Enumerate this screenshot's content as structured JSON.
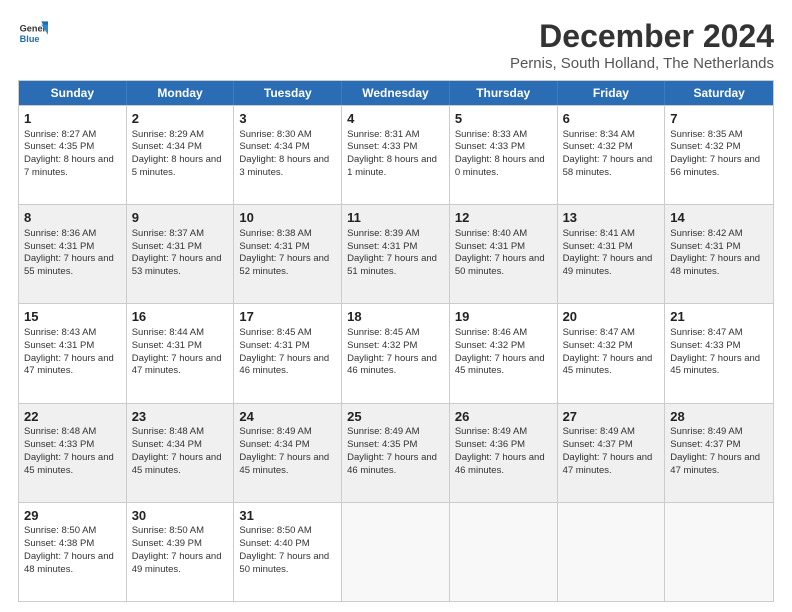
{
  "logo": {
    "line1": "General",
    "line2": "Blue"
  },
  "title": "December 2024",
  "subtitle": "Pernis, South Holland, The Netherlands",
  "headers": [
    "Sunday",
    "Monday",
    "Tuesday",
    "Wednesday",
    "Thursday",
    "Friday",
    "Saturday"
  ],
  "rows": [
    [
      {
        "day": "1",
        "info": "Sunrise: 8:27 AM\nSunset: 4:35 PM\nDaylight: 8 hours and 7 minutes."
      },
      {
        "day": "2",
        "info": "Sunrise: 8:29 AM\nSunset: 4:34 PM\nDaylight: 8 hours and 5 minutes."
      },
      {
        "day": "3",
        "info": "Sunrise: 8:30 AM\nSunset: 4:34 PM\nDaylight: 8 hours and 3 minutes."
      },
      {
        "day": "4",
        "info": "Sunrise: 8:31 AM\nSunset: 4:33 PM\nDaylight: 8 hours and 1 minute."
      },
      {
        "day": "5",
        "info": "Sunrise: 8:33 AM\nSunset: 4:33 PM\nDaylight: 8 hours and 0 minutes."
      },
      {
        "day": "6",
        "info": "Sunrise: 8:34 AM\nSunset: 4:32 PM\nDaylight: 7 hours and 58 minutes."
      },
      {
        "day": "7",
        "info": "Sunrise: 8:35 AM\nSunset: 4:32 PM\nDaylight: 7 hours and 56 minutes."
      }
    ],
    [
      {
        "day": "8",
        "info": "Sunrise: 8:36 AM\nSunset: 4:31 PM\nDaylight: 7 hours and 55 minutes.",
        "shaded": true
      },
      {
        "day": "9",
        "info": "Sunrise: 8:37 AM\nSunset: 4:31 PM\nDaylight: 7 hours and 53 minutes.",
        "shaded": true
      },
      {
        "day": "10",
        "info": "Sunrise: 8:38 AM\nSunset: 4:31 PM\nDaylight: 7 hours and 52 minutes.",
        "shaded": true
      },
      {
        "day": "11",
        "info": "Sunrise: 8:39 AM\nSunset: 4:31 PM\nDaylight: 7 hours and 51 minutes.",
        "shaded": true
      },
      {
        "day": "12",
        "info": "Sunrise: 8:40 AM\nSunset: 4:31 PM\nDaylight: 7 hours and 50 minutes.",
        "shaded": true
      },
      {
        "day": "13",
        "info": "Sunrise: 8:41 AM\nSunset: 4:31 PM\nDaylight: 7 hours and 49 minutes.",
        "shaded": true
      },
      {
        "day": "14",
        "info": "Sunrise: 8:42 AM\nSunset: 4:31 PM\nDaylight: 7 hours and 48 minutes.",
        "shaded": true
      }
    ],
    [
      {
        "day": "15",
        "info": "Sunrise: 8:43 AM\nSunset: 4:31 PM\nDaylight: 7 hours and 47 minutes."
      },
      {
        "day": "16",
        "info": "Sunrise: 8:44 AM\nSunset: 4:31 PM\nDaylight: 7 hours and 47 minutes."
      },
      {
        "day": "17",
        "info": "Sunrise: 8:45 AM\nSunset: 4:31 PM\nDaylight: 7 hours and 46 minutes."
      },
      {
        "day": "18",
        "info": "Sunrise: 8:45 AM\nSunset: 4:32 PM\nDaylight: 7 hours and 46 minutes."
      },
      {
        "day": "19",
        "info": "Sunrise: 8:46 AM\nSunset: 4:32 PM\nDaylight: 7 hours and 45 minutes."
      },
      {
        "day": "20",
        "info": "Sunrise: 8:47 AM\nSunset: 4:32 PM\nDaylight: 7 hours and 45 minutes."
      },
      {
        "day": "21",
        "info": "Sunrise: 8:47 AM\nSunset: 4:33 PM\nDaylight: 7 hours and 45 minutes."
      }
    ],
    [
      {
        "day": "22",
        "info": "Sunrise: 8:48 AM\nSunset: 4:33 PM\nDaylight: 7 hours and 45 minutes.",
        "shaded": true
      },
      {
        "day": "23",
        "info": "Sunrise: 8:48 AM\nSunset: 4:34 PM\nDaylight: 7 hours and 45 minutes.",
        "shaded": true
      },
      {
        "day": "24",
        "info": "Sunrise: 8:49 AM\nSunset: 4:34 PM\nDaylight: 7 hours and 45 minutes.",
        "shaded": true
      },
      {
        "day": "25",
        "info": "Sunrise: 8:49 AM\nSunset: 4:35 PM\nDaylight: 7 hours and 46 minutes.",
        "shaded": true
      },
      {
        "day": "26",
        "info": "Sunrise: 8:49 AM\nSunset: 4:36 PM\nDaylight: 7 hours and 46 minutes.",
        "shaded": true
      },
      {
        "day": "27",
        "info": "Sunrise: 8:49 AM\nSunset: 4:37 PM\nDaylight: 7 hours and 47 minutes.",
        "shaded": true
      },
      {
        "day": "28",
        "info": "Sunrise: 8:49 AM\nSunset: 4:37 PM\nDaylight: 7 hours and 47 minutes.",
        "shaded": true
      }
    ],
    [
      {
        "day": "29",
        "info": "Sunrise: 8:50 AM\nSunset: 4:38 PM\nDaylight: 7 hours and 48 minutes."
      },
      {
        "day": "30",
        "info": "Sunrise: 8:50 AM\nSunset: 4:39 PM\nDaylight: 7 hours and 49 minutes."
      },
      {
        "day": "31",
        "info": "Sunrise: 8:50 AM\nSunset: 4:40 PM\nDaylight: 7 hours and 50 minutes."
      },
      {
        "day": "",
        "info": "",
        "empty": true
      },
      {
        "day": "",
        "info": "",
        "empty": true
      },
      {
        "day": "",
        "info": "",
        "empty": true
      },
      {
        "day": "",
        "info": "",
        "empty": true
      }
    ]
  ]
}
